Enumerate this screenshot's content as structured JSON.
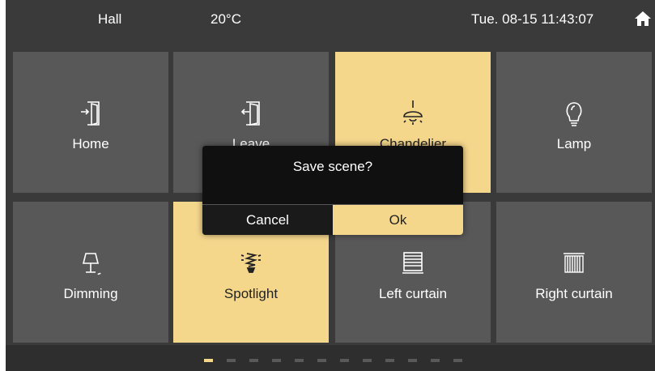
{
  "status": {
    "room": "Hall",
    "temperature": "20°C",
    "datetime": "Tue. 08-15 11:43:07",
    "home_icon": "home-icon"
  },
  "scenes": [
    {
      "label": "Home",
      "icon": "enter-door-icon",
      "active": false
    },
    {
      "label": "Leave",
      "icon": "exit-door-icon",
      "active": false
    },
    {
      "label": "Chandelier",
      "icon": "ceiling-lamp-icon",
      "active": true
    },
    {
      "label": "Lamp",
      "icon": "bulb-icon",
      "active": false
    },
    {
      "label": "Dimming",
      "icon": "table-lamp-icon",
      "active": false
    },
    {
      "label": "Spotlight",
      "icon": "spotlight-bulb-icon",
      "active": true
    },
    {
      "label": "Left curtain",
      "icon": "blinds-icon",
      "active": false
    },
    {
      "label": "Right curtain",
      "icon": "curtain-icon",
      "active": false
    }
  ],
  "pagination": {
    "current_page": 1,
    "total_pages": 12
  },
  "dialog": {
    "title": "Save scene?",
    "cancel_label": "Cancel",
    "ok_label": "Ok"
  },
  "colors": {
    "background": "#3a3a3a",
    "tile": "#585858",
    "accent": "#f5d78c",
    "dialog": "#101010"
  }
}
